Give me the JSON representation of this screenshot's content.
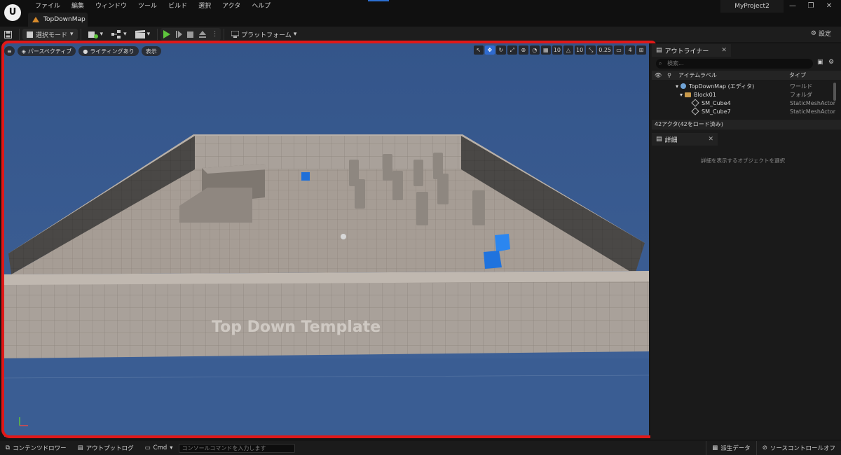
{
  "app": {
    "logo": "U",
    "menu": [
      "ファイル",
      "編集",
      "ウィンドウ",
      "ツール",
      "ビルド",
      "選択",
      "アクタ",
      "ヘルプ"
    ],
    "document_tab": "TopDownMap",
    "project_name": "MyProject2",
    "window_controls": [
      "—",
      "❐",
      "✕"
    ]
  },
  "toolbar": {
    "select_mode": "選択モード",
    "platform": "プラットフォーム",
    "settings": "設定"
  },
  "viewport": {
    "perspective": "パースペクティブ",
    "lighting": "ライティングあり",
    "show": "表示",
    "grid_snap": "10",
    "rotation_snap": "10",
    "scale_snap": "0.25",
    "camera_speed": "4",
    "scene_text": "Top Down Template"
  },
  "outliner": {
    "tab_label": "アウトライナー",
    "search_placeholder": "検索...",
    "col_label": "アイテムラベル",
    "col_type": "タイプ",
    "rows": [
      {
        "label": "TopDownMap (エディタ)",
        "type": "ワールド"
      },
      {
        "label": "Block01",
        "type": "フォルダ"
      },
      {
        "label": "SM_Cube4",
        "type": "StaticMeshActor"
      },
      {
        "label": "SM_Cube7",
        "type": "StaticMeshActor"
      }
    ],
    "actor_count": "42アクタ(42をロード済み)"
  },
  "details": {
    "tab_label": "詳細",
    "empty_message": "詳細を表示するオブジェクトを選択"
  },
  "statusbar": {
    "content_drawer": "コンテンツドロワー",
    "output_log": "アウトプットログ",
    "cmd": "Cmd",
    "console_placeholder": "コンソールコマンドを入力します",
    "derived_data": "派生データ",
    "source_control": "ソースコントロールオフ"
  },
  "colors": {
    "accent": "#2f6bd0",
    "play_green": "#5ec53c",
    "highlight_red": "#e01818",
    "viewport_sky": "#3a5a8f"
  }
}
